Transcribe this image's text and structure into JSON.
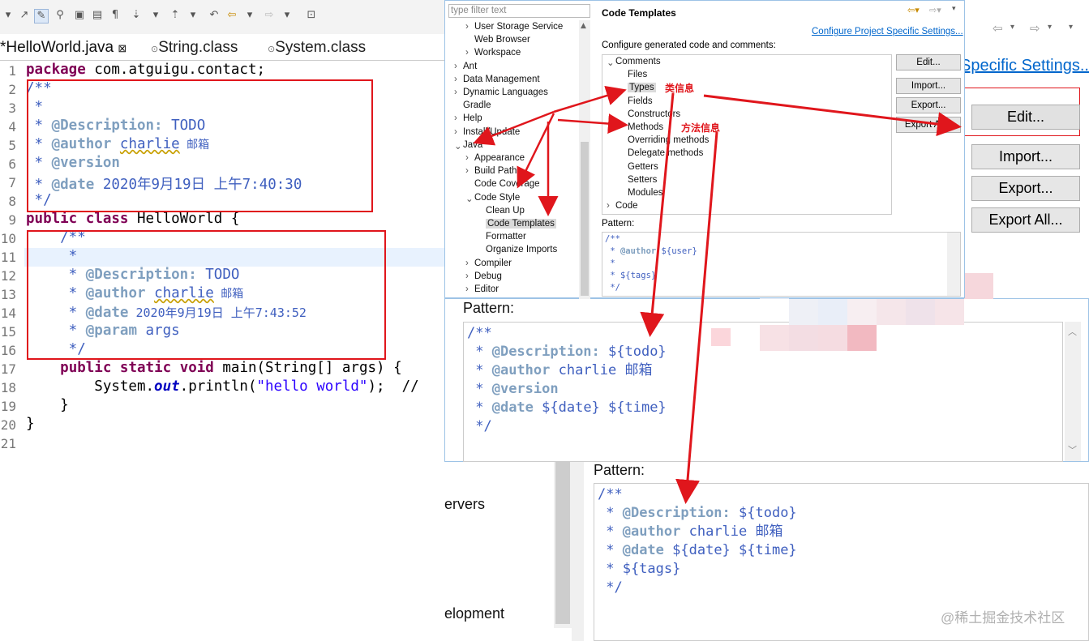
{
  "editor": {
    "tabs": [
      {
        "label": "*HelloWorld.java",
        "close": "⊠"
      },
      {
        "label": "String.class"
      },
      {
        "label": "System.class"
      }
    ],
    "line_numbers": [
      "1",
      "2",
      "3",
      "4",
      "5",
      "6",
      "7",
      "8",
      "9",
      "10",
      "11",
      "12",
      "13",
      "14",
      "15",
      "16",
      "17",
      "18",
      "19",
      "20",
      "21"
    ],
    "lines": {
      "l1_kw": "package",
      "l1_rest": " com.atguigu.contact;",
      "l2": "/**",
      "l3": " *",
      "l4_star": " * ",
      "l4_tag": "@Description:",
      "l4_rest": " TODO",
      "l5_star": " * ",
      "l5_tag": "@author",
      "l5_sp": " ",
      "l5_name": "charlie",
      "l5_rest": " 邮箱",
      "l6_star": " * ",
      "l6_tag": "@version",
      "l7_star": " * ",
      "l7_tag": "@date",
      "l7_rest": " 2020年9月19日 上午7:40:30",
      "l8": " */",
      "l9_kw1": "public",
      "l9_sp": " ",
      "l9_kw2": "class",
      "l9_rest": " HelloWorld {",
      "l10": "    /**",
      "l11": "     *",
      "l12_star": "     * ",
      "l12_tag": "@Description:",
      "l12_rest": " TODO",
      "l13_star": "     * ",
      "l13_tag": "@author",
      "l13_sp": " ",
      "l13_name": "charlie",
      "l13_rest": " 邮箱",
      "l14_star": "     * ",
      "l14_tag": "@date",
      "l14_rest": " 2020年9月19日 上午7:43:52",
      "l15_star": "     * ",
      "l15_tag": "@param",
      "l15_rest": " args",
      "l16": "     */",
      "l17_ind": "    ",
      "l17_kw1": "public",
      "l17_kw2": "static",
      "l17_kw3": "void",
      "l17_rest": " main(String[] args) {",
      "l18_a": "        System.",
      "l18_out": "out",
      "l18_b": ".println(",
      "l18_str": "\"hello world\"",
      "l18_c": ");  //",
      "l19": "    }",
      "l20": "}"
    }
  },
  "prefs_top": {
    "filter_placeholder": "type filter text",
    "tree": [
      "User Storage Service",
      "Web Browser",
      "Workspace",
      "Ant",
      "Data Management",
      "Dynamic Languages",
      "Gradle",
      "Help",
      "Install/Update",
      "Java",
      "Appearance",
      "Build Path",
      "Code Coverage",
      "Code Style",
      "Clean Up",
      "Code Templates",
      "Formatter",
      "Organize Imports",
      "Compiler",
      "Debug",
      "Editor"
    ],
    "page_title": "Code Templates",
    "project_link": "Configure Project Specific Settings...",
    "configure_label": "Configure generated code and comments:",
    "templates": [
      "Comments",
      "Files",
      "Types",
      "Fields",
      "Constructors",
      "Methods",
      "Overriding methods",
      "Delegate methods",
      "Getters",
      "Setters",
      "Modules",
      "Code"
    ],
    "buttons": [
      "Edit...",
      "Import...",
      "Export...",
      "Export All..."
    ],
    "pattern_label": "Pattern:",
    "pattern_lines": [
      "/**",
      " * @author ${user}",
      " *",
      " * ${tags}",
      " */"
    ]
  },
  "right_big": {
    "link": "Specific Settings...",
    "buttons": [
      "Edit...",
      "Import...",
      "Export...",
      "Export All..."
    ]
  },
  "pattern_types": {
    "label": "Pattern:",
    "lines": [
      "/**",
      " * @Description: ${todo}",
      " * @author charlie 邮箱",
      " * @version",
      " * @date ${date} ${time}",
      " */"
    ]
  },
  "pattern_methods": {
    "label": "Pattern:",
    "lines": [
      "/**",
      " * @Description: ${todo}",
      " * @author charlie 邮箱",
      " * @date ${date} ${time}",
      " * ${tags}",
      " */"
    ]
  },
  "left_partial": {
    "items": [
      "ervers",
      "elopment"
    ]
  },
  "annotations": {
    "types_note": "类信息",
    "methods_note": "方法信息"
  },
  "watermark": "@稀土掘金技术社区",
  "colors": {
    "annotation_red": "#e0161c",
    "keyword": "#7f0055",
    "javadoc": "#3f5fbf",
    "link": "#0066cc"
  }
}
